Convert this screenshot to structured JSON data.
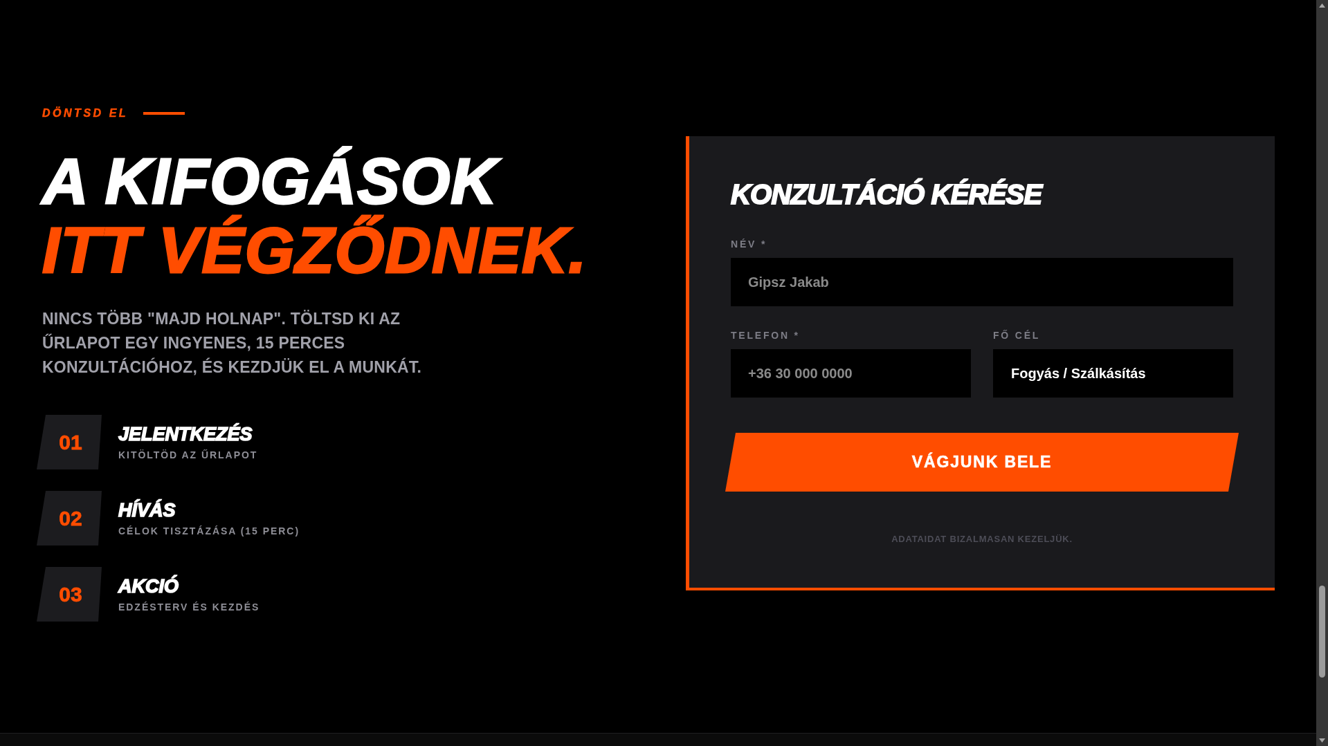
{
  "eyebrow": "DÖNTSD EL",
  "headline": {
    "line_1": "A KIFOGÁSOK",
    "line_2": "ITT VÉGZŐDNEK."
  },
  "intro": "NINCS TÖBB \"MAJD HOLNAP\". TÖLTSD KI AZ ŰRLAPOT EGY INGYENES, 15 PERCES KONZULTÁCIÓHOZ, ÉS KEZDJÜK EL A MUNKÁT.",
  "steps": [
    {
      "number": "01",
      "title": "JELENTKEZÉS",
      "subtitle": "KITÖLTÖD AZ ŰRLAPOT"
    },
    {
      "number": "02",
      "title": "HÍVÁS",
      "subtitle": "CÉLOK TISZTÁZÁSA (15 PERC)"
    },
    {
      "number": "03",
      "title": "AKCIÓ",
      "subtitle": "EDZÉSTERV ÉS KEZDÉS"
    }
  ],
  "form": {
    "title": "KONZULTÁCIÓ KÉRÉSE",
    "field_rows": [
      [
        {
          "kind": "input",
          "label": "NÉV *",
          "placeholder": "Gipsz Jakab"
        }
      ],
      [
        {
          "kind": "input",
          "label": "TELEFON *",
          "placeholder": "+36 30 000 0000"
        },
        {
          "kind": "select",
          "label": "FŐ CÉL",
          "value": "Fogyás / Szálkásítás"
        }
      ]
    ],
    "submit_button": "VÁGJUNK BELE",
    "note": "ADATAIDAT BIZALMASAN KEZELJÜK."
  }
}
